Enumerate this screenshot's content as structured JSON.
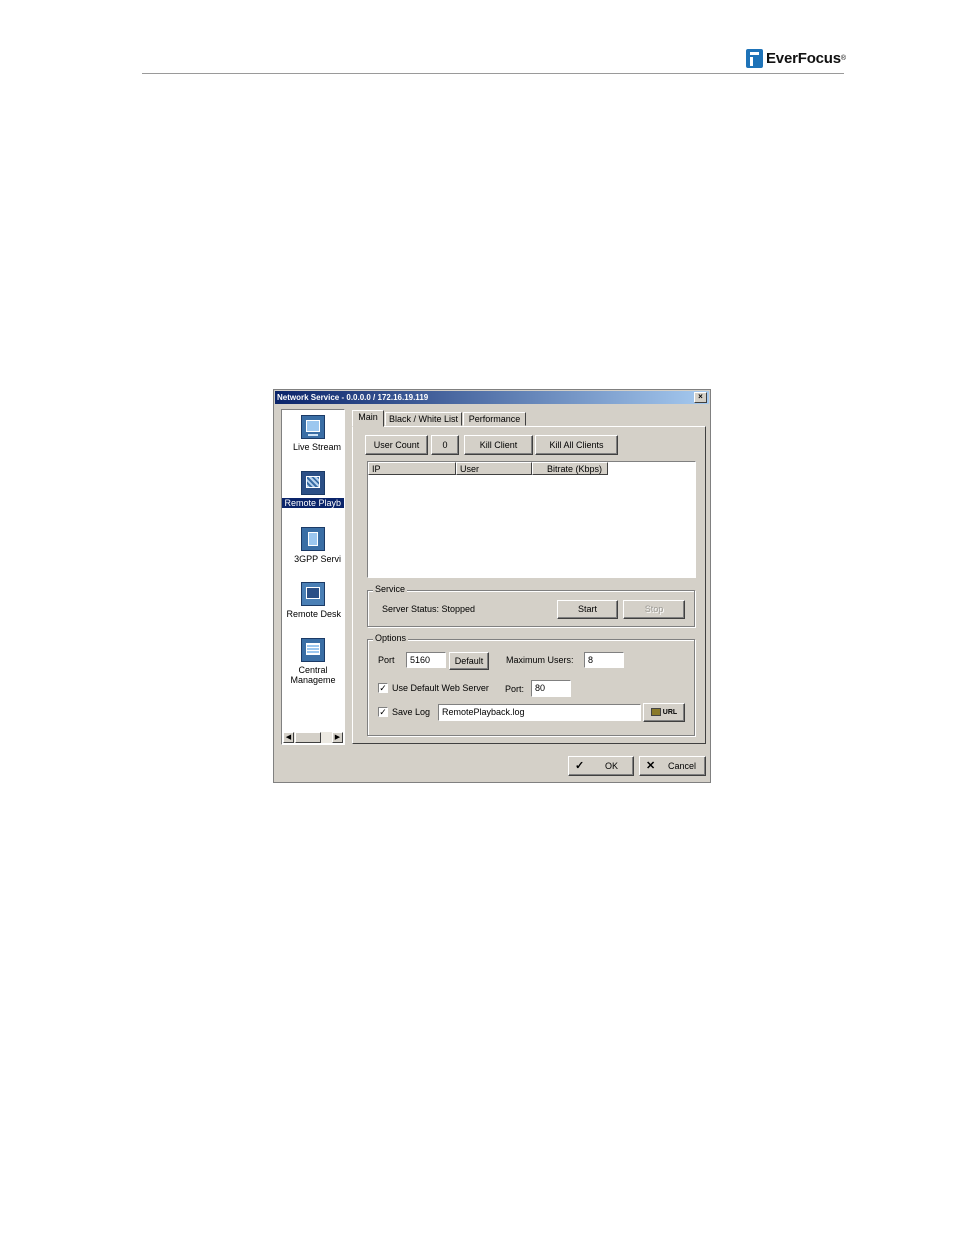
{
  "page": {
    "brand": "EverFocus",
    "brand_mark": "®"
  },
  "window": {
    "title": "Network Service - 0.0.0.0 / 172.16.19.119",
    "close_glyph": "×"
  },
  "sidebar": {
    "items": [
      {
        "label": "Live Stream",
        "icon": "live-stream-icon",
        "selected": false
      },
      {
        "label": "Remote Playb",
        "icon": "remote-playback-icon",
        "selected": true
      },
      {
        "label": "3GPP Servi",
        "icon": "3gpp-service-icon",
        "selected": false
      },
      {
        "label": "Remote Desk",
        "icon": "remote-desktop-icon",
        "selected": false
      },
      {
        "label": "Central\nManageme",
        "icon": "central-management-icon",
        "selected": false
      }
    ]
  },
  "tabs": [
    {
      "label": "Main",
      "active": true
    },
    {
      "label": "Black / White List",
      "active": false
    },
    {
      "label": "Performance",
      "active": false
    }
  ],
  "main": {
    "user_count_label": "User Count",
    "user_count_value": "0",
    "kill_client_label": "Kill Client",
    "kill_all_label": "Kill All Clients",
    "columns": [
      "IP",
      "User",
      "Bitrate (Kbps)"
    ],
    "rows": []
  },
  "service": {
    "group_title": "Service",
    "status_text": "Server Status: Stopped",
    "start_label": "Start",
    "stop_label": "Stop",
    "stop_enabled": false
  },
  "options": {
    "group_title": "Options",
    "port_label": "Port",
    "port_value": "5160",
    "default_label": "Default",
    "max_users_label": "Maximum Users:",
    "max_users_value": "8",
    "use_default_web_server_label": "Use Default Web Server",
    "use_default_web_server_checked": true,
    "web_port_label": "Port:",
    "web_port_value": "80",
    "save_log_label": "Save Log",
    "save_log_checked": true,
    "log_file_value": "RemotePlayback.log",
    "url_button_label": "URL"
  },
  "footer": {
    "ok_label": "OK",
    "cancel_label": "Cancel"
  }
}
